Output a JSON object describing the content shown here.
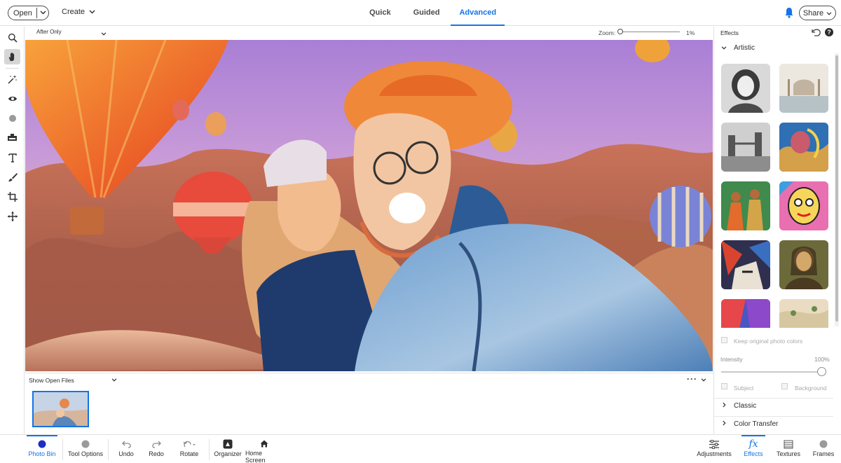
{
  "topbar": {
    "open_label": "Open",
    "create_label": "Create",
    "modes": [
      "Quick",
      "Guided",
      "Advanced"
    ],
    "active_mode": "Advanced",
    "share_label": "Share",
    "accent_color": "#1473e6"
  },
  "canvas": {
    "view_label": "After Only",
    "zoom_label": "Zoom:",
    "zoom_value": "1%"
  },
  "photo_bin": {
    "show_label": "Show Open Files"
  },
  "effects_panel": {
    "title": "Effects",
    "sections": {
      "artistic": "Artistic",
      "classic": "Classic",
      "color_transfer": "Color Transfer"
    },
    "keep_colors_label": "Keep original photo colors",
    "intensity_label": "Intensity",
    "intensity_value": "100%",
    "subject_label": "Subject",
    "background_label": "Background"
  },
  "bottombar": {
    "left_items": [
      "Photo Bin",
      "Tool Options",
      "Undo",
      "Redo",
      "Rotate",
      "Organizer",
      "Home Screen"
    ],
    "right_items": [
      "Adjustments",
      "Effects",
      "Textures",
      "Frames"
    ],
    "active_left": "Photo Bin",
    "active_right": "Effects"
  }
}
